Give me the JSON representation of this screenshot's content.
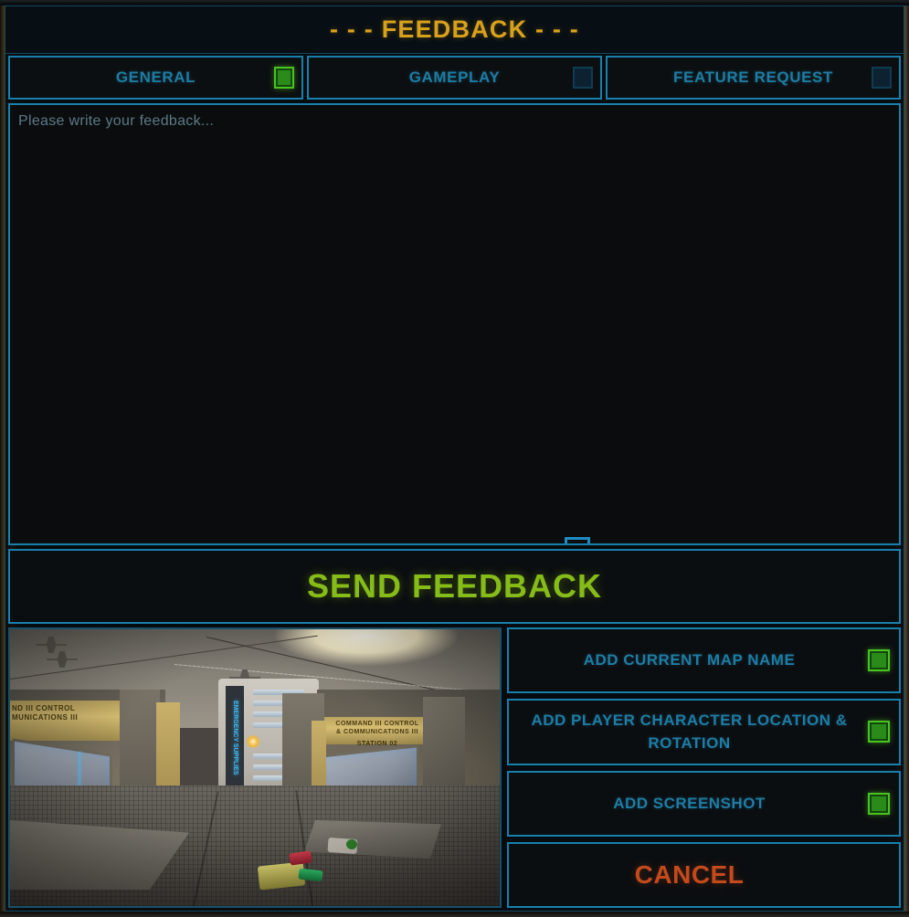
{
  "window": {
    "title": "- - - FEEDBACK - - -"
  },
  "tabs": [
    {
      "label": "GENERAL",
      "checked": true,
      "name": "tab-general"
    },
    {
      "label": "GAMEPLAY",
      "checked": false,
      "name": "tab-gameplay"
    },
    {
      "label": "FEATURE REQUEST",
      "checked": false,
      "name": "tab-feature-request"
    }
  ],
  "editor": {
    "placeholder": "Please write your feedback...",
    "value": ""
  },
  "send": {
    "label": "SEND FEEDBACK"
  },
  "options": [
    {
      "label": "ADD CURRENT MAP NAME",
      "checked": true,
      "name": "option-add-current-map-name"
    },
    {
      "label": "ADD PLAYER CHARACTER LOCATION & ROTATION",
      "checked": true,
      "name": "option-add-player-location-rotation"
    },
    {
      "label": "ADD SCREENSHOT",
      "checked": true,
      "name": "option-add-screenshot"
    }
  ],
  "cancel": {
    "label": "CANCEL"
  },
  "thumbnail": {
    "sign_left": "ND III CONTROL\nMUNICATIONS III",
    "sign_right": "COMMAND III CONTROL\n& COMMUNICATIONS III",
    "sign_right_sub": "STATION 02",
    "cabinet_label": "EMERGENCY SUPPLIES"
  },
  "colors": {
    "accent_blue": "#1880ab",
    "label_blue": "#1f7ca3",
    "title_gold": "#d8a11c",
    "send_green": "#86bc18",
    "cancel_red": "#c44a1c",
    "check_green": "#2a8a1a",
    "check_green_border": "#4cc222",
    "panel_bg": "#0b0e10"
  }
}
